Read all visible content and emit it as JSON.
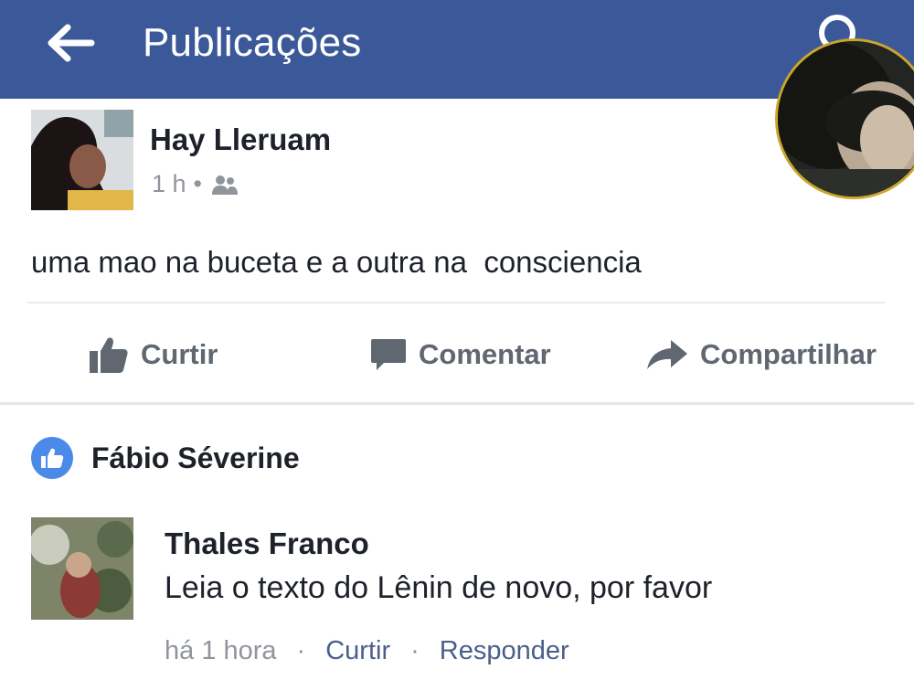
{
  "header": {
    "title": "Publicações",
    "back_icon": "arrow-left-icon",
    "search_icon": "search-icon",
    "background": "#3b5998"
  },
  "post": {
    "author": "Hay Lleruam",
    "time": "1 h",
    "dot": "•",
    "audience_icon": "friends-icon",
    "text": "uma mao na buceta e a outra na  consciencia"
  },
  "actions": {
    "like_label": "Curtir",
    "comment_label": "Comentar",
    "share_label": "Compartilhar"
  },
  "likes": {
    "name": "Fábio Séverine",
    "badge_color": "#4b8ae8"
  },
  "comment": {
    "author": "Thales Franco",
    "text": "Leia o texto do Lênin de novo, por favor",
    "time": "há 1 hora",
    "separator": "·",
    "like_label": "Curtir",
    "reply_label": "Responder"
  }
}
